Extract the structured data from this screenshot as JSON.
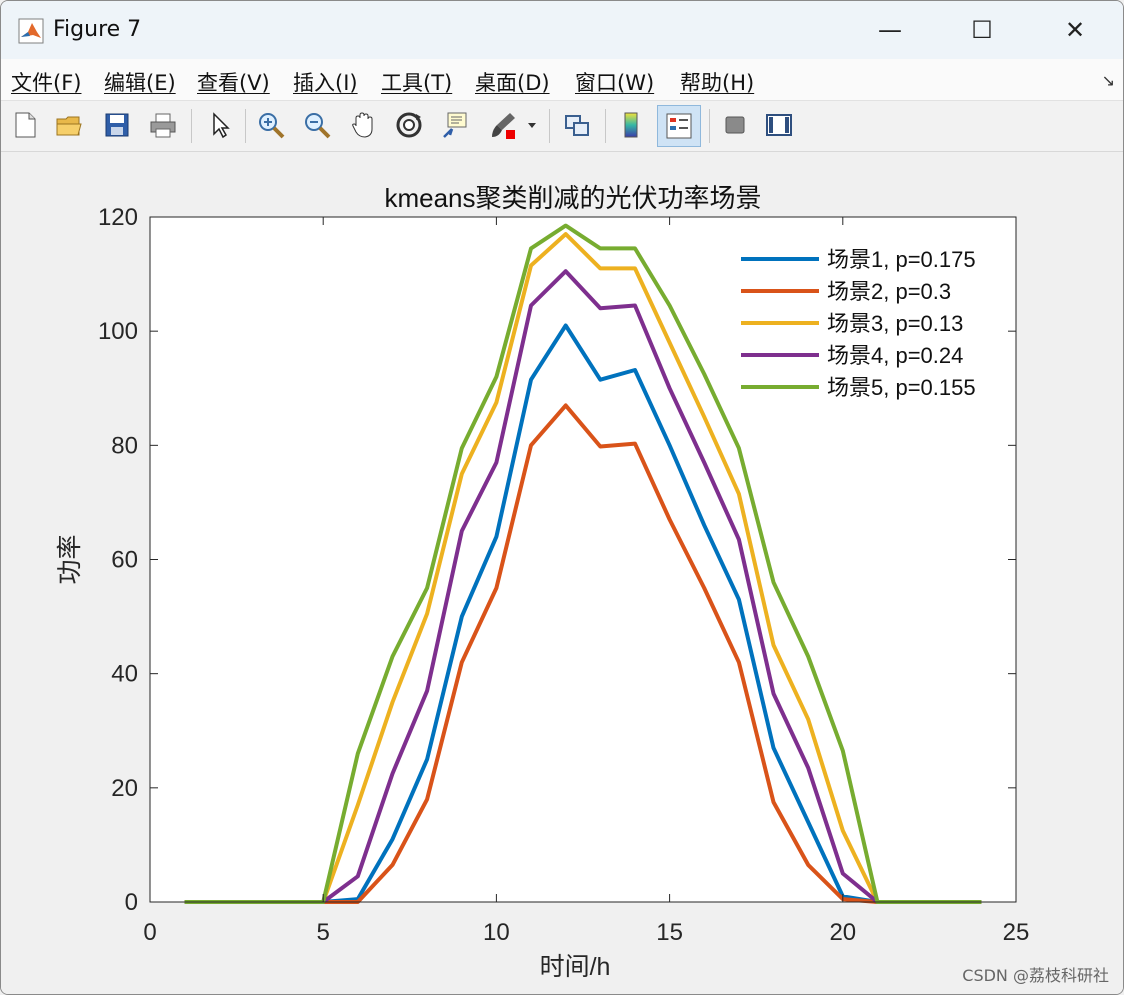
{
  "window": {
    "title": "Figure 7",
    "minimize_glyph": "—",
    "maximize_glyph": "☐",
    "close_glyph": "✕"
  },
  "menu": {
    "items": [
      "文件(F)",
      "编辑(E)",
      "查看(V)",
      "插入(I)",
      "工具(T)",
      "桌面(D)",
      "窗口(W)",
      "帮助(H)"
    ],
    "corner_glyph": "↘"
  },
  "toolbar": {
    "icons": [
      "new-figure-icon",
      "open-file-icon",
      "save-icon",
      "print-icon",
      "pointer-icon",
      "zoom-in-icon",
      "zoom-out-icon",
      "pan-hand-icon",
      "rotate-3d-icon",
      "data-cursor-icon",
      "brush-icon",
      "link-plot-icon",
      "colorbar-icon",
      "legend-icon",
      "hide-plot-tools-icon",
      "show-plot-tools-icon"
    ]
  },
  "chart_data": {
    "type": "line",
    "title": "kmeans聚类削减的光伏功率场景",
    "xlabel": "时间/h",
    "ylabel": "功率",
    "xlim": [
      0,
      25
    ],
    "ylim": [
      0,
      120
    ],
    "xticks": [
      0,
      5,
      10,
      15,
      20,
      25
    ],
    "yticks": [
      0,
      20,
      40,
      60,
      80,
      100,
      120
    ],
    "grid": false,
    "legend_position": "top-right",
    "x": [
      1,
      2,
      3,
      4,
      5,
      6,
      7,
      8,
      9,
      10,
      11,
      12,
      13,
      14,
      15,
      16,
      17,
      18,
      19,
      20,
      21,
      22,
      23,
      24
    ],
    "series": [
      {
        "name": "场景1, p=0.175",
        "color": "#0072BD",
        "values": [
          0,
          0,
          0,
          0,
          0,
          0.5,
          11,
          25,
          50,
          64,
          91.5,
          101,
          91.5,
          93.2,
          80,
          66,
          53,
          27,
          14,
          1,
          0,
          0,
          0,
          0
        ]
      },
      {
        "name": "场景2, p=0.3",
        "color": "#D95319",
        "values": [
          0,
          0,
          0,
          0,
          0,
          0,
          6.5,
          18,
          42,
          55,
          80,
          87,
          79.8,
          80.3,
          67,
          55,
          42,
          17.5,
          6.5,
          0.5,
          0,
          0,
          0,
          0
        ]
      },
      {
        "name": "场景3, p=0.13",
        "color": "#EDB120",
        "values": [
          0,
          0,
          0,
          0,
          0,
          17,
          35,
          50.5,
          75,
          87.5,
          111.5,
          117,
          111,
          111,
          98,
          85,
          71.5,
          45,
          32,
          12.5,
          0,
          0,
          0,
          0
        ]
      },
      {
        "name": "场景4, p=0.24",
        "color": "#7E2F8E",
        "values": [
          0,
          0,
          0,
          0,
          0,
          4.5,
          22.5,
          37,
          65,
          77,
          104.5,
          110.5,
          104,
          104.5,
          90,
          77,
          63.5,
          36.5,
          23.5,
          5,
          0,
          0,
          0,
          0
        ]
      },
      {
        "name": "场景5, p=0.155",
        "color": "#77AC30",
        "values": [
          0,
          0,
          0,
          0,
          0,
          26,
          43,
          55,
          79.5,
          92,
          114.5,
          118.5,
          114.5,
          114.5,
          104.5,
          92.5,
          79.5,
          56,
          43,
          26.5,
          0,
          0,
          0,
          0
        ]
      }
    ]
  },
  "watermark": "CSDN @荔枝科研社"
}
